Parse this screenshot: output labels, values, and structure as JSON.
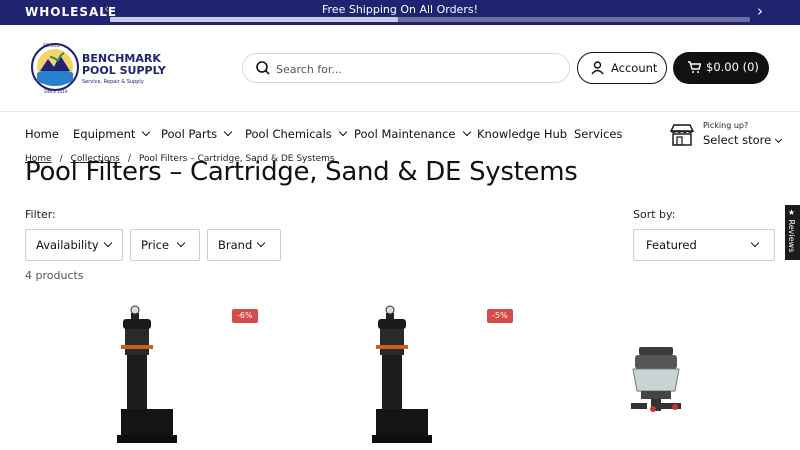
{
  "announcement": {
    "label": "WHOLESALE",
    "message": "Free Shipping On All Orders!",
    "progress_fraction": 0.45
  },
  "brand": {
    "line1": "BENCHMARK",
    "line2": "POOL SUPPLY",
    "tagline": "Service, Repair & Supply",
    "arc_top": "SERVICE",
    "arc_bottom": "SINCE 2019"
  },
  "search": {
    "placeholder": "Search for..."
  },
  "account": {
    "label": "Account"
  },
  "cart": {
    "label": "$0.00 (0)"
  },
  "nav": {
    "items": [
      {
        "label": "Home",
        "has_menu": false
      },
      {
        "label": "Equipment",
        "has_menu": true
      },
      {
        "label": "Pool Parts",
        "has_menu": true
      },
      {
        "label": "Pool Chemicals",
        "has_menu": true
      },
      {
        "label": "Pool Maintenance",
        "has_menu": true
      },
      {
        "label": "Knowledge Hub",
        "has_menu": false
      },
      {
        "label": "Services",
        "has_menu": false
      }
    ],
    "store_small": "Picking up?",
    "store_big": "Select store"
  },
  "breadcrumb": {
    "home": "Home",
    "collections": "Collections",
    "current": "Pool Filters – Cartridge, Sand & DE Systems",
    "sep": "/"
  },
  "page_title": "Pool Filters – Cartridge, Sand & DE Systems",
  "filters": {
    "label": "Filter:",
    "availability": "Availability",
    "price": "Price",
    "brand": "Brand"
  },
  "sort": {
    "label": "Sort by:",
    "value": "Featured"
  },
  "product_count": "4 products",
  "products": [
    {
      "badge": "-6%"
    },
    {
      "badge": "-5%"
    },
    {
      "badge": ""
    }
  ],
  "reviews_tab": "★ Reviews",
  "colors": {
    "navy": "#1f2370",
    "badge_red": "#d84a4a",
    "black": "#111111"
  }
}
